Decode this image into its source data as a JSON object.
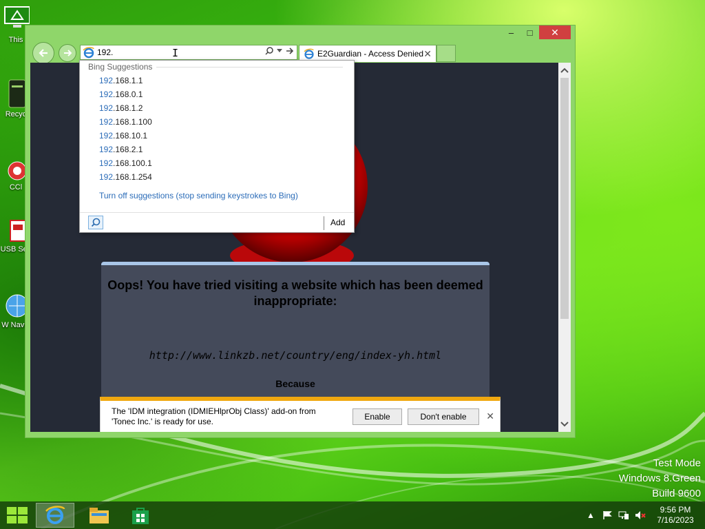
{
  "desktop": {
    "icons": [
      {
        "label": "This",
        "icon": "computer-icon"
      },
      {
        "label": "Recyc",
        "icon": "recycle-bin-icon"
      },
      {
        "label": "CCl",
        "icon": "ccleaner-icon"
      },
      {
        "label": "USB Sec",
        "icon": "usb-security-icon"
      },
      {
        "label": "W Navig",
        "icon": "navigator-globe-icon"
      }
    ],
    "watermark": {
      "line1": "Test Mode",
      "line2": "Windows 8.Green",
      "line3": "Build 9600"
    }
  },
  "browser": {
    "address_value": "192.",
    "tab": {
      "title": "E2Guardian - Access Denied",
      "icon": "ie-icon"
    },
    "controls": {
      "minimize": "–",
      "maximize": "□",
      "close": "✕"
    },
    "suggestions": {
      "header": "Bing Suggestions",
      "typed": "192",
      "items": [
        ".168.1.1",
        ".168.0.1",
        ".168.1.2",
        ".168.1.100",
        ".168.10.1",
        ".168.2.1",
        ".168.100.1",
        ".168.1.254"
      ],
      "turn_off": "Turn off suggestions (stop sending keystrokes to Bing)",
      "add_label": "Add"
    },
    "page": {
      "title": "Oops! You have tried visiting a website which has been deemed inappropriate:",
      "url": "http://www.linkzb.net/country/eng/index-yh.html",
      "because": "Because"
    },
    "notification": {
      "text": "The 'IDM integration (IDMIEHlprObj Class)' add-on from 'Tonec Inc.' is ready for use.",
      "enable": "Enable",
      "dont_enable": "Don't enable"
    }
  },
  "taskbar": {
    "items": [
      "start-icon",
      "internet-explorer-icon",
      "file-explorer-icon",
      "store-icon"
    ],
    "clock": {
      "time": "9:56 PM",
      "date": "7/16/2023"
    }
  },
  "colors": {
    "link": "#2b6cb8",
    "page_background": "#252a36",
    "message_box": "#444a5a",
    "notification_accent": "#f0a810",
    "window_frame": "#8fd66a"
  }
}
